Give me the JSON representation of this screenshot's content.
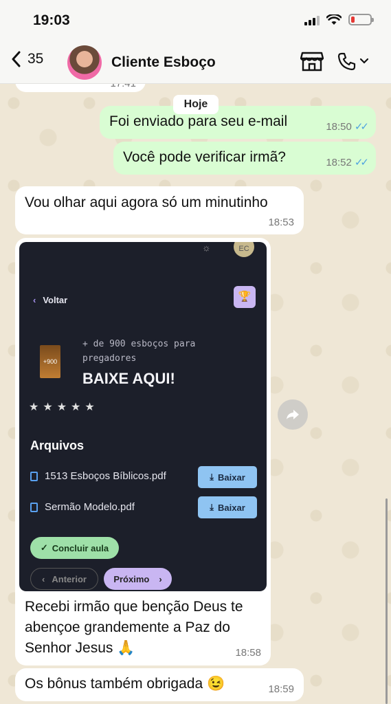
{
  "status_bar": {
    "time": "19:03"
  },
  "header": {
    "back_count": "35",
    "contact_name": "Cliente Esboço"
  },
  "chat": {
    "date_chip": "Hoje",
    "messages": [
      {
        "dir": "in",
        "text": "",
        "time": "17:41"
      },
      {
        "dir": "out",
        "text": "Foi enviado para seu e-mail",
        "time": "18:50",
        "ticks": "✓✓"
      },
      {
        "dir": "out",
        "text": "Você pode verificar irmã?",
        "time": "18:52",
        "ticks": "✓✓"
      },
      {
        "dir": "in",
        "text": "Vou olhar aqui agora só um minutinho",
        "time": "18:53"
      },
      {
        "dir": "in",
        "caption": "Recebi irmão que benção Deus te abençoe grandemente a Paz do Senhor Jesus 🙏",
        "time": "18:58"
      },
      {
        "dir": "in",
        "text": "Os bônus também obrigada 😉",
        "time": "18:59"
      }
    ]
  },
  "screenshot": {
    "avatar_initials": "EC",
    "back_label": "Voltar",
    "book_label": "+900",
    "promo_text": "+ de 900 esboços para pregadores",
    "cta": "BAIXE AQUI!",
    "stars": "★★★★★",
    "files_title": "Arquivos",
    "files": [
      {
        "name": "1513 Esboços Bíblicos.pdf",
        "button": "Baixar"
      },
      {
        "name": "Sermão Modelo.pdf",
        "button": "Baixar"
      }
    ],
    "complete_button": "Concluir aula",
    "prev_button": "Anterior",
    "next_button": "Próximo"
  }
}
